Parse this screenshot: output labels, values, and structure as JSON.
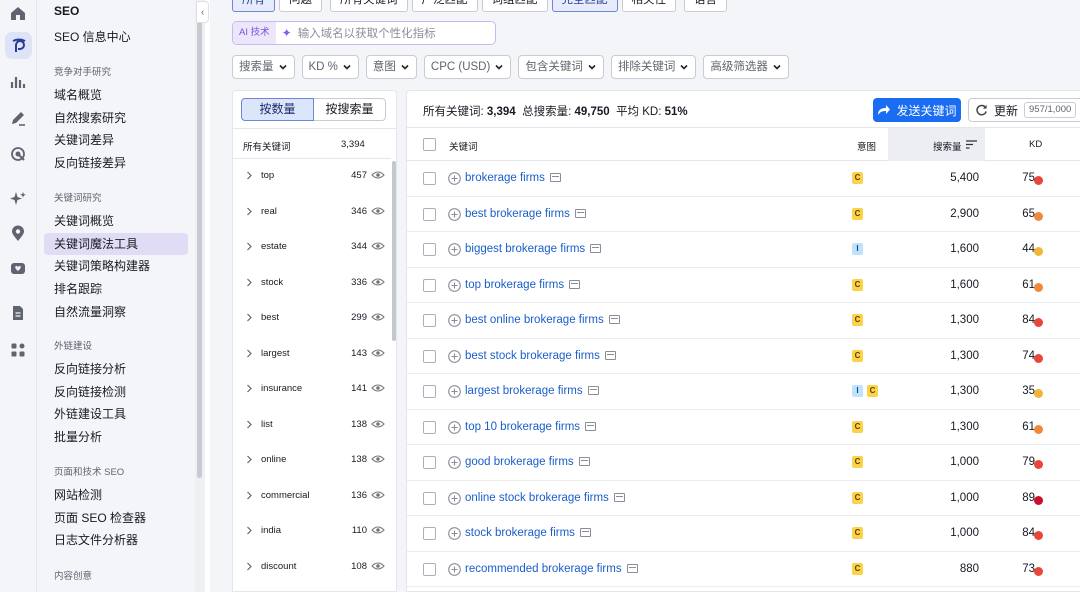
{
  "colors": {
    "accent": "#1a6cf2",
    "kd_red": "#e8463b",
    "kd_orange": "#f08a3a",
    "kd_yellow": "#f2b637",
    "kd_darkred": "#c8102e",
    "intent_c": "#fcd24a",
    "intent_i": "#c2e2fb",
    "ai_purple": "#7b4fe0"
  },
  "sidebar": {
    "title": "SEO",
    "seo_hub": "SEO 信息中心",
    "sections": [
      {
        "label": "竞争对手研究",
        "items": [
          "域名概览",
          "自然搜索研究",
          "关键词差异",
          "反向链接差异"
        ]
      },
      {
        "label": "关键词研究",
        "items": [
          "关键词概览",
          "关键词魔法工具",
          "关键词策略构建器",
          "排名跟踪",
          "自然流量洞察"
        ]
      },
      {
        "label": "外链建设",
        "items": [
          "反向链接分析",
          "反向链接检测",
          "外链建设工具",
          "批量分析"
        ]
      },
      {
        "label": "页面和技术 SEO",
        "items": [
          "网站检测",
          "页面 SEO 检查器",
          "日志文件分析器"
        ]
      },
      {
        "label": "内容创意",
        "items": []
      }
    ],
    "active_item": "关键词魔法工具",
    "rail_icons": [
      "home-icon",
      "seo-icon",
      "chart-bar-icon",
      "pen-icon",
      "target-icon",
      "sparkle-icon",
      "location-pin-icon",
      "heart-chat-icon",
      "document-icon",
      "apps-grid-icon"
    ],
    "collapse_glyph": "‹"
  },
  "tabs": [
    "所有",
    "问题",
    "所有关键词",
    "广泛匹配",
    "词组匹配",
    "完全匹配",
    "相关性",
    "语言"
  ],
  "selected_tabs": [
    "所有",
    "完全匹配"
  ],
  "ai": {
    "tag": "AI 技术",
    "placeholder": "输入域名以获取个性化指标"
  },
  "filters": [
    "搜索量",
    "KD %",
    "意图",
    "CPC (USD)",
    "包含关键词",
    "排除关键词",
    "高级筛选器"
  ],
  "left_panel": {
    "seg": [
      "按数量",
      "按搜索量"
    ],
    "header_label": "所有关键词",
    "header_count": "3,394",
    "groups": [
      {
        "word": "top",
        "count": "457"
      },
      {
        "word": "real",
        "count": "346"
      },
      {
        "word": "estate",
        "count": "344"
      },
      {
        "word": "stock",
        "count": "336"
      },
      {
        "word": "best",
        "count": "299"
      },
      {
        "word": "largest",
        "count": "143"
      },
      {
        "word": "insurance",
        "count": "141"
      },
      {
        "word": "list",
        "count": "138"
      },
      {
        "word": "online",
        "count": "138"
      },
      {
        "word": "commercial",
        "count": "136"
      },
      {
        "word": "india",
        "count": "110"
      },
      {
        "word": "discount",
        "count": "108"
      }
    ]
  },
  "summary": {
    "all_label": "所有关键词:",
    "all_value": "3,394",
    "vol_label": "总搜索量:",
    "vol_value": "49,750",
    "kd_label": "平均 KD:",
    "kd_value": "51%"
  },
  "actions": {
    "send": "发送关键词",
    "update": "更新",
    "update_count": "957/1,000"
  },
  "table": {
    "columns": {
      "keyword": "关键词",
      "intent": "意图",
      "volume": "搜索量",
      "kd": "KD"
    },
    "rows": [
      {
        "keyword": "brokerage firms",
        "intents": [
          "C"
        ],
        "volume": "5,400",
        "kd": "75",
        "kd_color": "#e8463b"
      },
      {
        "keyword": "best brokerage firms",
        "intents": [
          "C"
        ],
        "volume": "2,900",
        "kd": "65",
        "kd_color": "#f08a3a"
      },
      {
        "keyword": "biggest brokerage firms",
        "intents": [
          "I"
        ],
        "volume": "1,600",
        "kd": "44",
        "kd_color": "#f2b637"
      },
      {
        "keyword": "top brokerage firms",
        "intents": [
          "C"
        ],
        "volume": "1,600",
        "kd": "61",
        "kd_color": "#f08a3a"
      },
      {
        "keyword": "best online brokerage firms",
        "intents": [
          "C"
        ],
        "volume": "1,300",
        "kd": "84",
        "kd_color": "#e8463b"
      },
      {
        "keyword": "best stock brokerage firms",
        "intents": [
          "C"
        ],
        "volume": "1,300",
        "kd": "74",
        "kd_color": "#e8463b"
      },
      {
        "keyword": "largest brokerage firms",
        "intents": [
          "I",
          "C"
        ],
        "volume": "1,300",
        "kd": "35",
        "kd_color": "#f2b637"
      },
      {
        "keyword": "top 10 brokerage firms",
        "intents": [
          "C"
        ],
        "volume": "1,300",
        "kd": "61",
        "kd_color": "#f08a3a"
      },
      {
        "keyword": "good brokerage firms",
        "intents": [
          "C"
        ],
        "volume": "1,000",
        "kd": "79",
        "kd_color": "#e8463b"
      },
      {
        "keyword": "online stock brokerage firms",
        "intents": [
          "C"
        ],
        "volume": "1,000",
        "kd": "89",
        "kd_color": "#c8102e"
      },
      {
        "keyword": "stock brokerage firms",
        "intents": [
          "C"
        ],
        "volume": "1,000",
        "kd": "84",
        "kd_color": "#e8463b"
      },
      {
        "keyword": "recommended brokerage firms",
        "intents": [
          "C"
        ],
        "volume": "880",
        "kd": "73",
        "kd_color": "#e8463b"
      }
    ]
  }
}
